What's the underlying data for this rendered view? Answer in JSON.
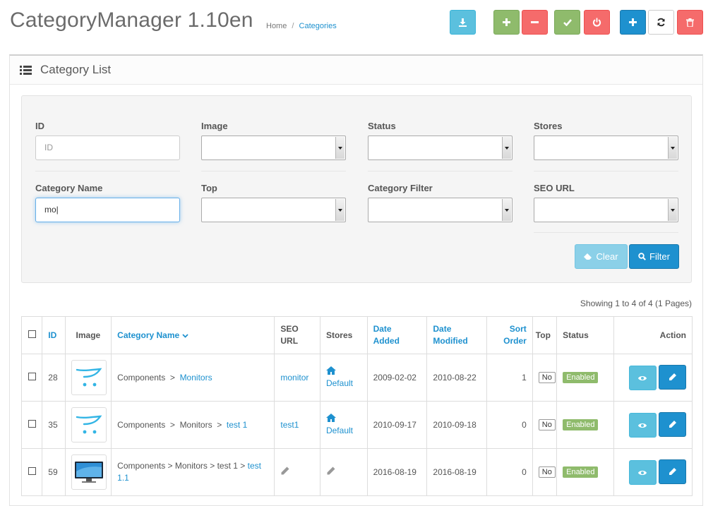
{
  "header": {
    "title": "CategoryManager 1.10en",
    "breadcrumb": [
      "Home",
      "Categories"
    ]
  },
  "toolbar": {
    "buttons": [
      {
        "name": "export-button",
        "icon": "download-icon",
        "style": "info"
      },
      {
        "name": "expand-button",
        "icon": "plus-icon",
        "style": "success"
      },
      {
        "name": "collapse-button",
        "icon": "minus-icon",
        "style": "danger"
      },
      {
        "name": "enable-button",
        "icon": "check-icon",
        "style": "success"
      },
      {
        "name": "disable-button",
        "icon": "power-icon",
        "style": "danger"
      },
      {
        "name": "add-button",
        "icon": "plus-icon",
        "style": "primary"
      },
      {
        "name": "refresh-button",
        "icon": "refresh-icon",
        "style": "default"
      },
      {
        "name": "delete-button",
        "icon": "trash-icon",
        "style": "danger"
      }
    ]
  },
  "panel": {
    "title": "Category List"
  },
  "filter": {
    "id_label": "ID",
    "id_placeholder": "ID",
    "id_value": "",
    "image_label": "Image",
    "status_label": "Status",
    "stores_label": "Stores",
    "name_label": "Category Name",
    "name_value": "mo",
    "top_label": "Top",
    "category_filter_label": "Category Filter",
    "seo_label": "SEO URL",
    "clear_label": "Clear",
    "filter_label": "Filter"
  },
  "results_text": "Showing 1 to 4 of 4 (1 Pages)",
  "table": {
    "headers": {
      "id": "ID",
      "image": "Image",
      "name": "Category Name",
      "seo": "SEO URL",
      "stores": "Stores",
      "date_added": "Date Added",
      "date_modified": "Date Modified",
      "sort_order": "Sort Order",
      "top": "Top",
      "status": "Status",
      "action": "Action"
    },
    "rows": [
      {
        "id": "28",
        "image": "opencart-cart-icon",
        "path": [
          "Components"
        ],
        "name": "Monitors",
        "seo": "monitor",
        "store": "Default",
        "date_added": "2009-02-02",
        "date_modified": "2010-08-22",
        "sort_order": "1",
        "top": "No",
        "status": "Enabled"
      },
      {
        "id": "35",
        "image": "opencart-cart-icon",
        "path": [
          "Components",
          "Monitors"
        ],
        "name": "test 1",
        "seo": "test1",
        "store": "Default",
        "date_added": "2010-09-17",
        "date_modified": "2010-09-18",
        "sort_order": "0",
        "top": "No",
        "status": "Enabled"
      },
      {
        "id": "59",
        "image": "monitor-icon",
        "path_text": "Components > Monitors > test 1 >",
        "name": "test 1.1",
        "seo": "",
        "store": "",
        "date_added": "2016-08-19",
        "date_modified": "2016-08-19",
        "sort_order": "0",
        "top": "No",
        "status": "Enabled"
      }
    ]
  },
  "colors": {
    "primary": "#1e91cf",
    "info": "#5bc0de",
    "success": "#8fbb6c",
    "danger": "#f56b6b"
  }
}
